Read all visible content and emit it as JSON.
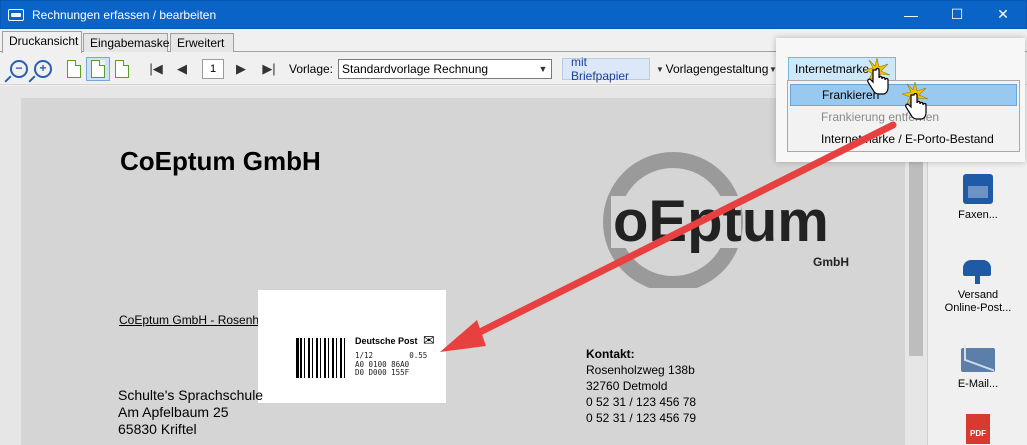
{
  "window": {
    "title": "Rechnungen erfassen / bearbeiten",
    "minimize": "—",
    "maximize": "☐",
    "close": "✕"
  },
  "tabs": [
    "Druckansicht",
    "Eingabemaske",
    "Erweitert"
  ],
  "toolbar": {
    "zoom_out": "−",
    "zoom_in": "+",
    "page_number": "1",
    "vorlage_label": "Vorlage:",
    "vorlage_value": "Standardvorlage Rechnung",
    "briefpapier_button": "mit Briefpapier",
    "vorlagengestaltung": "Vorlagengestaltung",
    "internetmarke_button": "Internetmarke"
  },
  "menu": {
    "items": [
      {
        "label": "Frankieren"
      },
      {
        "label": "Frankierung entfernen"
      },
      {
        "label": "Internetmarke / E-Porto-Bestand"
      }
    ]
  },
  "document": {
    "company": "CoEptum GmbH",
    "logo_main": "oEptum",
    "logo_sub": "GmbH",
    "sender_line": "CoEptum GmbH - Rosenholzweg 138b - 32760 Detmold",
    "stamp": {
      "brand": "Deutsche Post",
      "line1_left": "1/12",
      "line1_right": "0.55",
      "line2": "A0 0100 86A0",
      "line3": "D0 D000 155F"
    },
    "contact": {
      "heading": "Kontakt:",
      "street": "Rosenholzweg 138b",
      "city": "32760 Detmold",
      "phone1": "0 52 31 / 123 456 78",
      "phone2": "0 52 31 / 123 456 79"
    },
    "recipient": {
      "name": "Schulte's Sprachschule",
      "street": "Am Apfelbaum 25",
      "city": "65830 Kriftel"
    }
  },
  "side_panel": {
    "fax": "Faxen...",
    "online_post_1": "Versand",
    "online_post_2": "Online-Post...",
    "email": "E-Mail...",
    "pdf": "PDF"
  },
  "colors": {
    "titlebar": "#0a64c8",
    "menu_highlight": "#99c9ef",
    "arrow": "#e8403f",
    "icon_blue": "#1f5aa6"
  }
}
